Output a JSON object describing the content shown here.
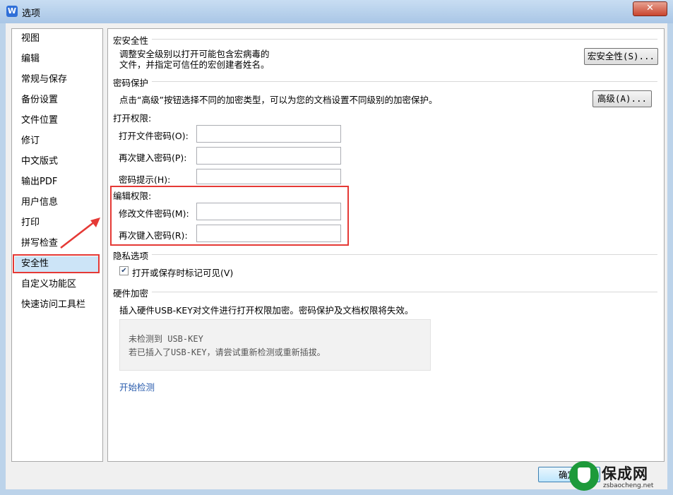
{
  "window": {
    "title": "选项",
    "app_icon": "W",
    "close_label": "✕"
  },
  "sidebar": {
    "items": [
      {
        "label": "视图"
      },
      {
        "label": "编辑"
      },
      {
        "label": "常规与保存"
      },
      {
        "label": "备份设置"
      },
      {
        "label": "文件位置"
      },
      {
        "label": "修订"
      },
      {
        "label": "中文版式"
      },
      {
        "label": "输出PDF"
      },
      {
        "label": "用户信息"
      },
      {
        "label": "打印"
      },
      {
        "label": "拼写检查"
      },
      {
        "label": "安全性",
        "selected": true
      },
      {
        "label": "自定义功能区"
      },
      {
        "label": "快速访问工具栏"
      }
    ]
  },
  "macro": {
    "title": "宏安全性",
    "desc1": "调整安全级别以打开可能包含宏病毒的",
    "desc2": "文件，并指定可信任的宏创建者姓名。",
    "button": "宏安全性(S)..."
  },
  "password": {
    "title": "密码保护",
    "desc": "点击“高级”按钮选择不同的加密类型，可以为您的文档设置不同级别的加密保护。",
    "advanced_button": "高级(A)...",
    "open_title": "打开权限:",
    "open_password_label": "打开文件密码(O):",
    "open_confirm_label": "再次键入密码(P):",
    "hint_label": "密码提示(H):",
    "edit_title": "编辑权限:",
    "edit_password_label": "修改文件密码(M):",
    "edit_confirm_label": "再次键入密码(R):"
  },
  "privacy": {
    "title": "隐私选项",
    "checkbox_label": "打开或保存时标记可见(V)",
    "checked": true
  },
  "hardware": {
    "title": "硬件加密",
    "desc": "插入硬件USB-KEY对文件进行打开权限加密。密码保护及文档权限将失效。",
    "status_line1": "未检测到 USB-KEY",
    "status_line2": "若已插入了USB-KEY，请尝试重新检测或重新插拔。",
    "detect_link": "开始检测"
  },
  "footer": {
    "ok_label": "确定"
  },
  "watermark": {
    "title": "保成网",
    "subtitle": "zsbaocheng.net"
  },
  "colors": {
    "highlight": "#e53935",
    "link": "#2a5cad",
    "selected": "#cce4f7"
  }
}
